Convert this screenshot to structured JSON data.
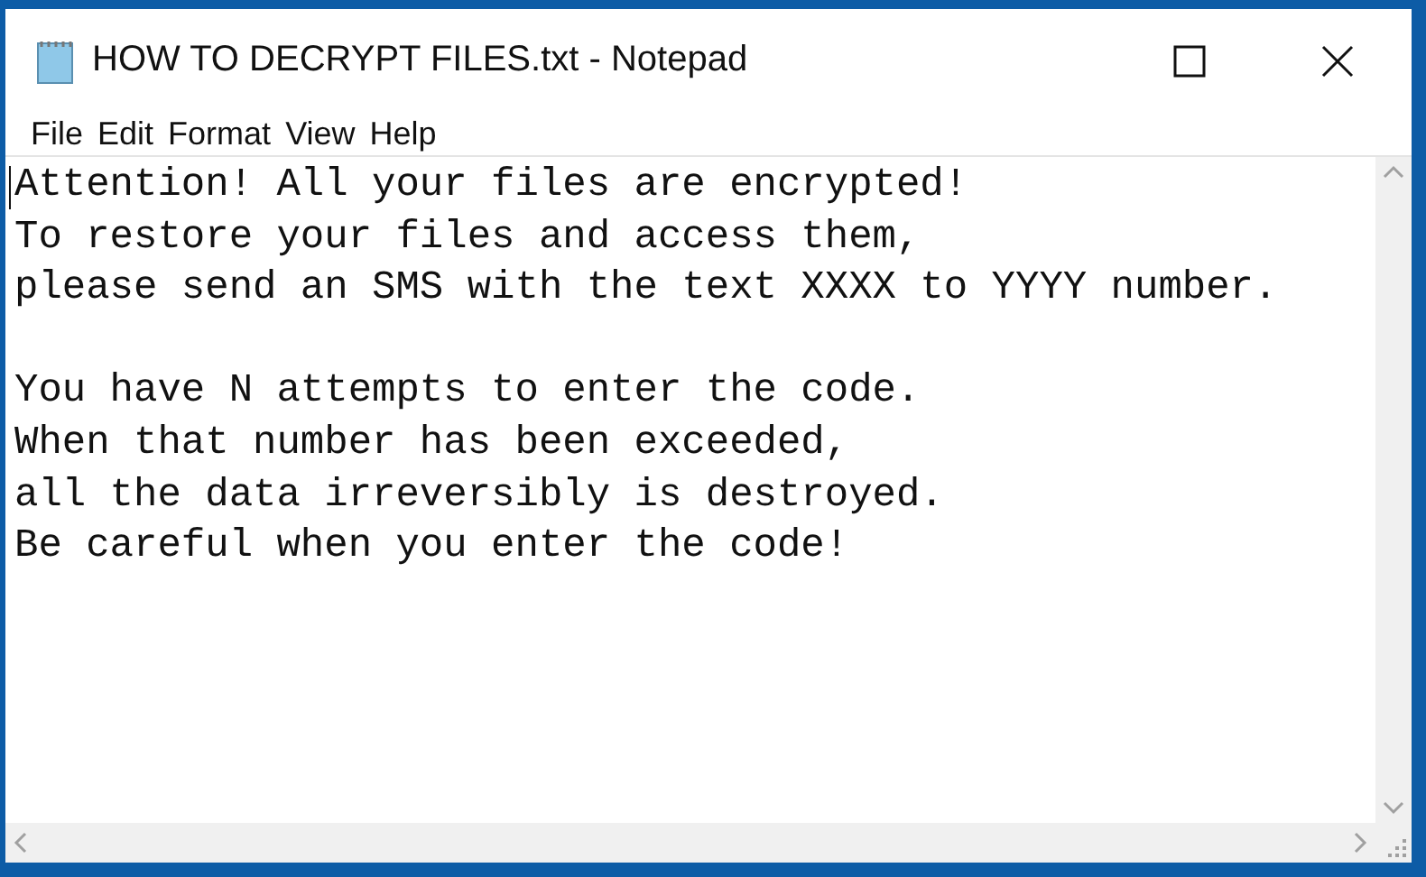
{
  "window": {
    "title": "HOW TO DECRYPT FILES.txt - Notepad"
  },
  "menu": [
    "File",
    "Edit",
    "Format",
    "View",
    "Help"
  ],
  "document": {
    "paragraphs": [
      [
        "Attention! All your files are encrypted!",
        "To restore your files and access them,",
        "please send an SMS with the text XXXX to YYYY number."
      ],
      [
        "You have N attempts to enter the code.",
        "When that number has been exceeded,",
        "all the data irreversibly is destroyed.",
        "Be careful when you enter the code!"
      ]
    ]
  }
}
